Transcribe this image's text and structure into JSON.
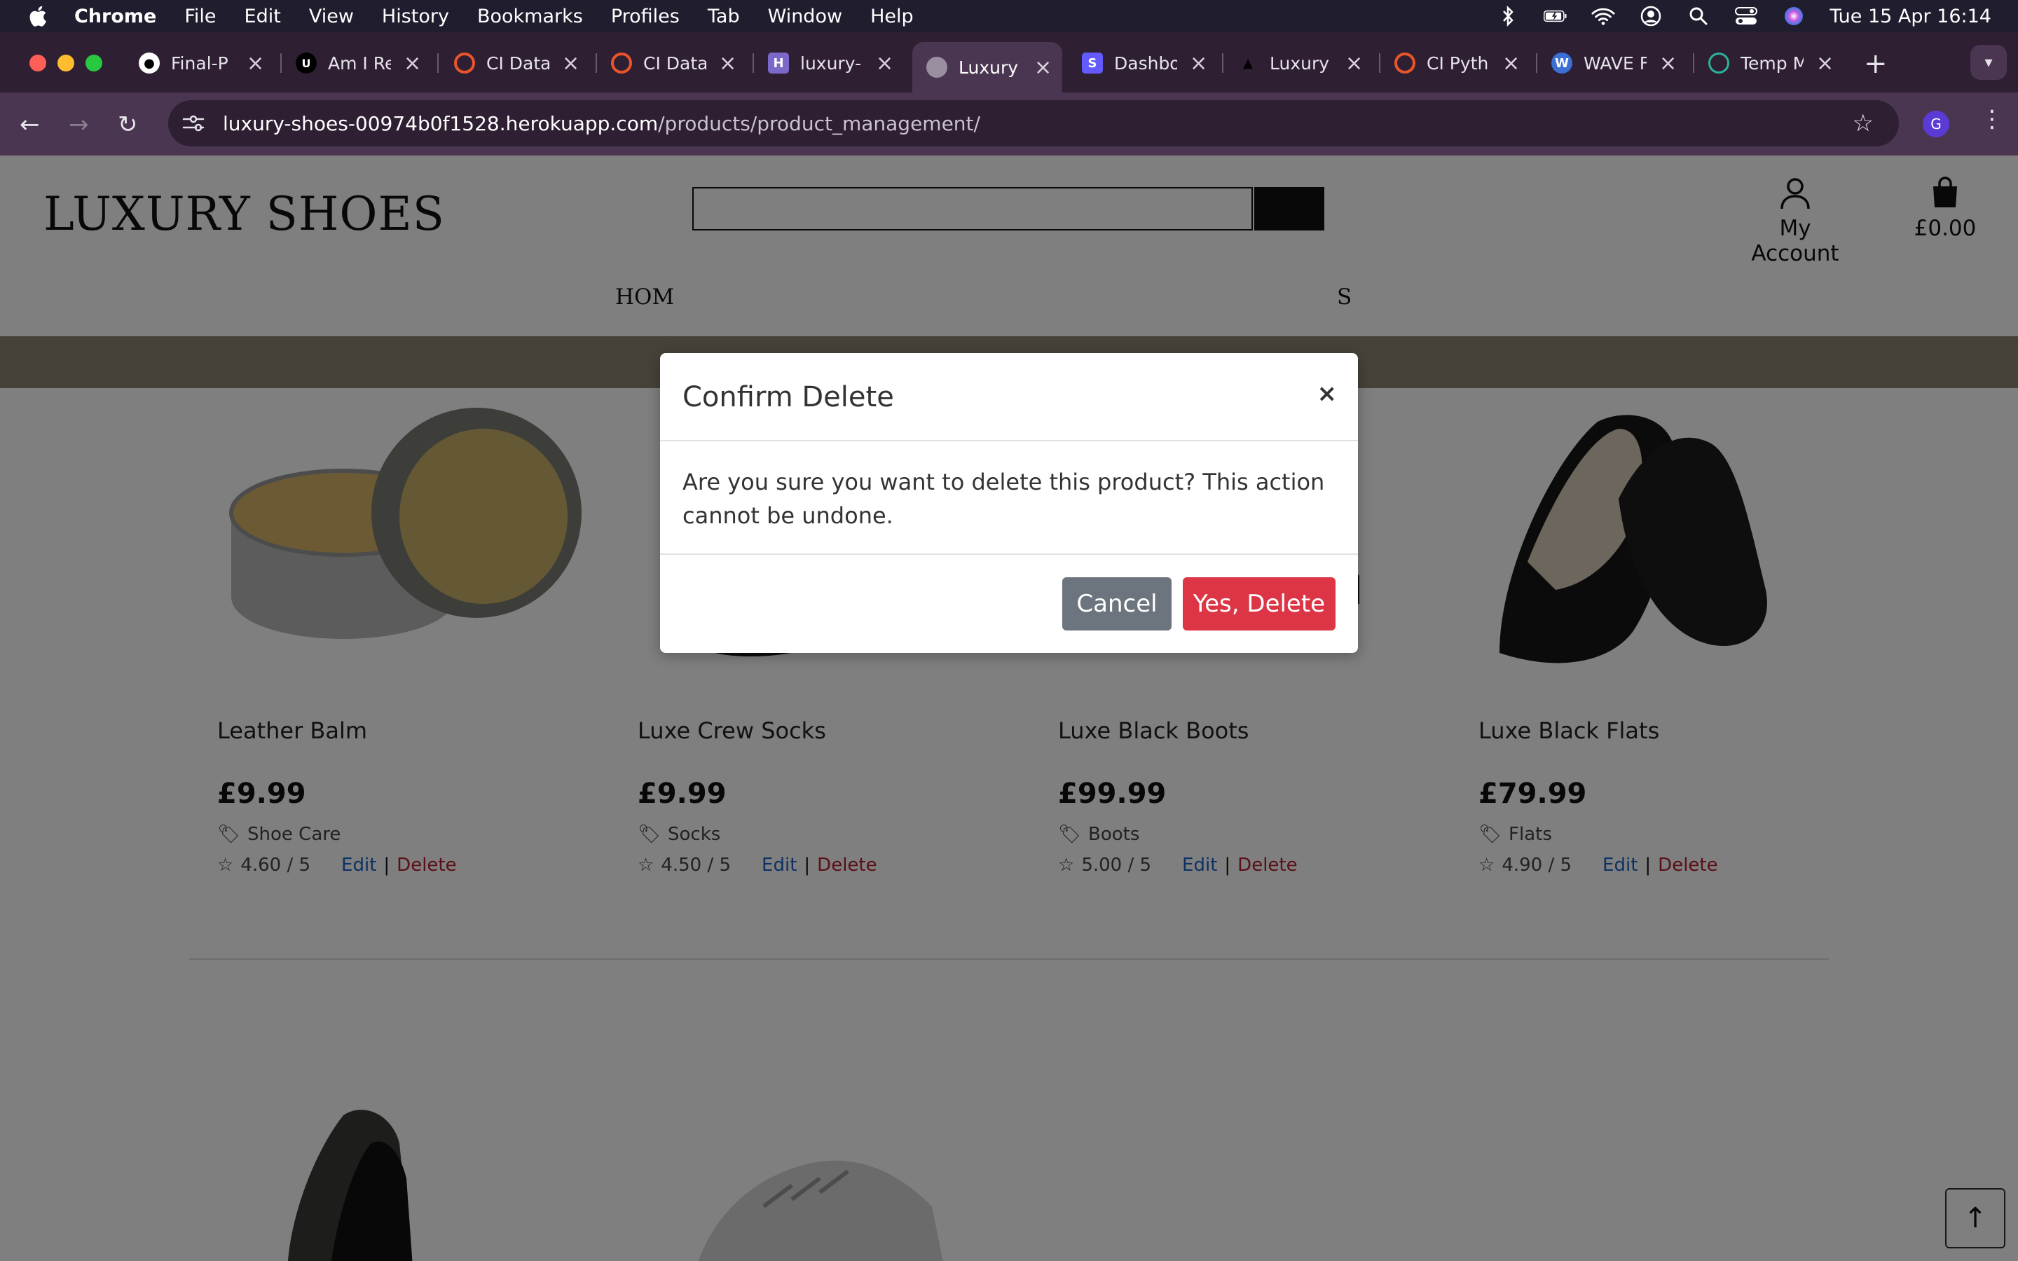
{
  "menubar": {
    "app_name": "Chrome",
    "items": [
      "File",
      "Edit",
      "View",
      "History",
      "Bookmarks",
      "Profiles",
      "Tab",
      "Window",
      "Help"
    ],
    "datetime": "Tue 15 Apr  16:14"
  },
  "tabs": [
    {
      "title": "Final-P",
      "icon": "github-icon",
      "color": "#ffffff"
    },
    {
      "title": "Am I Re",
      "icon": "ui-icon",
      "color": "#000000"
    },
    {
      "title": "CI Data",
      "icon": "ci-icon",
      "color": "#e8552a"
    },
    {
      "title": "CI Data",
      "icon": "ci-icon",
      "color": "#e8552a"
    },
    {
      "title": "luxury-",
      "icon": "heroku-icon",
      "color": "#7b68c8"
    },
    {
      "title": "Luxury",
      "icon": "globe-icon",
      "color": "#9a8fa0",
      "active": true
    },
    {
      "title": "Dashbo",
      "icon": "stripe-icon",
      "color": "#635bff"
    },
    {
      "title": "Luxury",
      "icon": "shoe-icon",
      "color": "#000000"
    },
    {
      "title": "CI Pyth",
      "icon": "ci-icon",
      "color": "#e8552a"
    },
    {
      "title": "WAVE F",
      "icon": "wave-icon",
      "color": "#3b6fd4"
    },
    {
      "title": "Temp M",
      "icon": "temp-icon",
      "color": "#2bb39a"
    }
  ],
  "address": {
    "host": "luxury-shoes-00974b0f1528.herokuapp.com",
    "path": "/products/product_management/"
  },
  "profile_initial": "G",
  "site": {
    "logo": "LUXURY SHOES",
    "account_label": "My Account",
    "bag_total": "£0.00",
    "nav_left": "HOM",
    "nav_right": "S"
  },
  "products": [
    {
      "name": "Leather Balm",
      "price": "£9.99",
      "category": "Shoe Care",
      "rating": "4.60 / 5"
    },
    {
      "name": "Luxe Crew Socks",
      "price": "£9.99",
      "category": "Socks",
      "rating": "4.50 / 5"
    },
    {
      "name": "Luxe Black Boots",
      "price": "£99.99",
      "category": "Boots",
      "rating": "5.00 / 5"
    },
    {
      "name": "Luxe Black Flats",
      "price": "£79.99",
      "category": "Flats",
      "rating": "4.90 / 5"
    }
  ],
  "product_actions": {
    "edit": "Edit",
    "separator": "|",
    "delete": "Delete"
  },
  "modal": {
    "title": "Confirm Delete",
    "close": "×",
    "body": "Are you sure you want to delete this product? This action cannot be undone.",
    "cancel": "Cancel",
    "confirm": "Yes, Delete"
  },
  "colors": {
    "danger": "#dc3545",
    "secondary": "#6c757d",
    "link": "#1d62c6",
    "promo_bar": "#8f8472"
  }
}
